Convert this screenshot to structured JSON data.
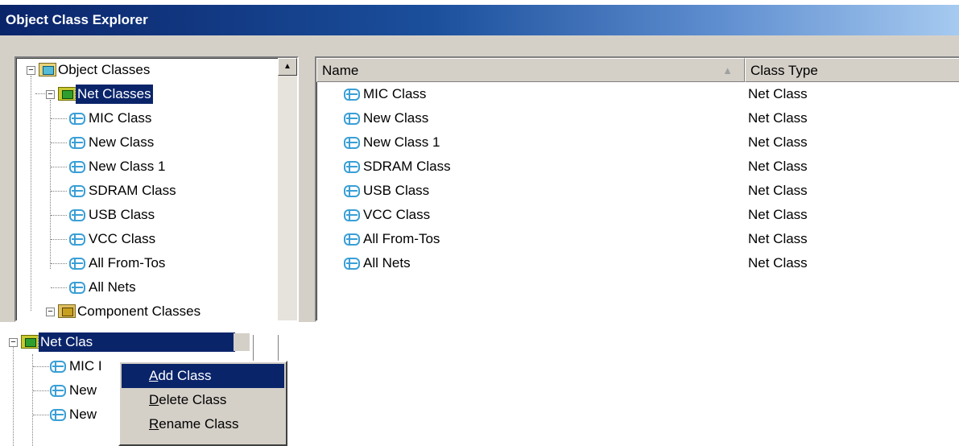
{
  "window": {
    "title": "Object Class Explorer"
  },
  "tree": {
    "root": {
      "label": "Object Classes",
      "icon": "image-folder-icon"
    },
    "net_classes": {
      "label": "Net Classes",
      "icon": "net-classes-folder-icon"
    },
    "net_items": [
      "MIC Class",
      "New Class",
      "New Class 1",
      "SDRAM Class",
      "USB Class",
      "VCC Class",
      "All From-Tos",
      "All Nets"
    ],
    "component_classes": {
      "label": "Component Classes",
      "icon": "component-classes-folder-icon"
    }
  },
  "list": {
    "columns": {
      "name": "Name",
      "class_type": "Class Type"
    },
    "sort_indicator": "▲",
    "rows": [
      {
        "name": "MIC Class",
        "type": "Net Class"
      },
      {
        "name": "New Class",
        "type": "Net Class"
      },
      {
        "name": "New Class 1",
        "type": "Net Class"
      },
      {
        "name": "SDRAM Class",
        "type": "Net Class"
      },
      {
        "name": "USB Class",
        "type": "Net Class"
      },
      {
        "name": "VCC Class",
        "type": "Net Class"
      },
      {
        "name": "All From-Tos",
        "type": "Net Class"
      },
      {
        "name": "All Nets",
        "type": "Net Class"
      }
    ]
  },
  "inset": {
    "tree_label": "Net Clas",
    "rows": [
      "MIC I",
      "New",
      "New"
    ],
    "menu": {
      "items": [
        {
          "first": "A",
          "rest": "dd Class"
        },
        {
          "first": "D",
          "rest": "elete Class"
        },
        {
          "first": "R",
          "rest": "ename Class"
        }
      ]
    }
  }
}
